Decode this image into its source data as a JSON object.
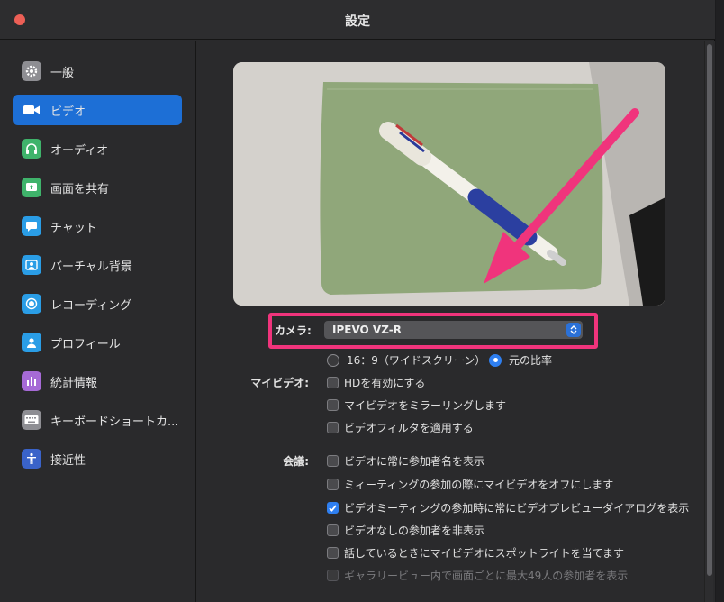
{
  "window": {
    "title": "設定"
  },
  "sidebar": {
    "items": [
      {
        "label": "一般",
        "icon": "gear-icon",
        "color": "#8e8e93",
        "active": false
      },
      {
        "label": "ビデオ",
        "icon": "video-camera-icon",
        "color": "#1d6fd6",
        "active": true
      },
      {
        "label": "オーディオ",
        "icon": "headphones-icon",
        "color": "#3fb36b",
        "active": false
      },
      {
        "label": "画面を共有",
        "icon": "share-screen-icon",
        "color": "#3fb36b",
        "active": false
      },
      {
        "label": "チャット",
        "icon": "chat-bubble-icon",
        "color": "#2a9de6",
        "active": false
      },
      {
        "label": "バーチャル背景",
        "icon": "virtual-background-icon",
        "color": "#2a9de6",
        "active": false
      },
      {
        "label": "レコーディング",
        "icon": "record-icon",
        "color": "#2a9de6",
        "active": false
      },
      {
        "label": "プロフィール",
        "icon": "profile-icon",
        "color": "#2a9de6",
        "active": false
      },
      {
        "label": "統計情報",
        "icon": "statistics-icon",
        "color": "#a66ad6",
        "active": false
      },
      {
        "label": "キーボードショートカ...",
        "icon": "keyboard-icon",
        "color": "#8e8e93",
        "active": false
      },
      {
        "label": "接近性",
        "icon": "accessibility-icon",
        "color": "#3a63c9",
        "active": false
      }
    ]
  },
  "video": {
    "camera_label": "カメラ:",
    "camera_value": "IPEVO VZ-R",
    "highlight_color": "#f0347c",
    "aspect": {
      "option_wide": "16：9（ワイドスクリーン）",
      "option_original": "元の比率",
      "selected": "original"
    },
    "my_video": {
      "label": "マイビデオ:",
      "options": [
        {
          "label": "HDを有効にする",
          "checked": false
        },
        {
          "label": "マイビデオをミラーリングします",
          "checked": false
        },
        {
          "label": "ビデオフィルタを適用する",
          "checked": false
        }
      ]
    },
    "meeting": {
      "label": "会議:",
      "options": [
        {
          "label": "ビデオに常に参加者名を表示",
          "checked": false,
          "disabled": false
        },
        {
          "label": "ミィーティングの参加の際にマイビデオをオフにします",
          "checked": false,
          "disabled": false
        },
        {
          "label": "ビデオミーティングの参加時に常にビデオプレビューダイアログを表示",
          "checked": true,
          "disabled": false
        },
        {
          "label": "ビデオなしの参加者を非表示",
          "checked": false,
          "disabled": false
        },
        {
          "label": "話しているときにマイビデオにスポットライトを当てます",
          "checked": false,
          "disabled": false
        },
        {
          "label": "ギャラリービュー内で画面ごとに最大49人の参加者を表示",
          "checked": false,
          "disabled": true
        }
      ]
    }
  }
}
